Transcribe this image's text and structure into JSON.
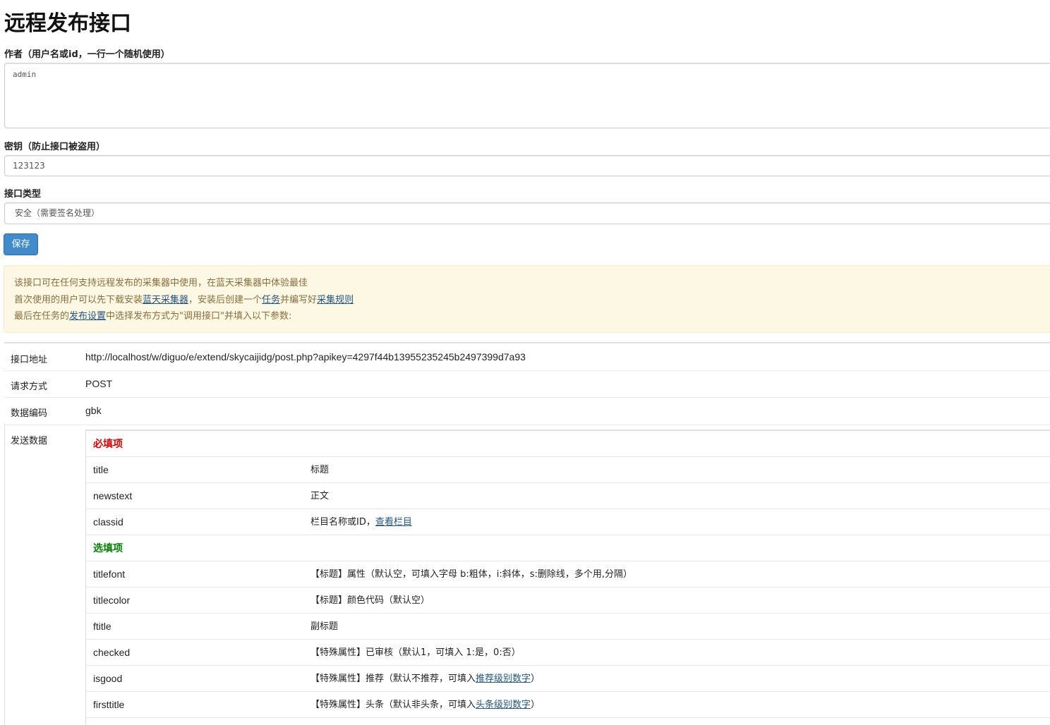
{
  "page": {
    "title": "远程发布接口"
  },
  "author": {
    "label": "作者（用户名或id，一行一个随机使用）",
    "value": "admin"
  },
  "key": {
    "label": "密钥（防止接口被盗用）",
    "value": "123123"
  },
  "api_type": {
    "label": "接口类型",
    "selected": "安全（需要签名处理）"
  },
  "save_button": "保存",
  "notice": {
    "line1": "该接口可在任何支持远程发布的采集器中使用，在蓝天采集器中体验最佳",
    "line2_a": "首次使用的用户可以先下载安装",
    "line2_link1": "蓝天采集器",
    "line2_b": "，安装后创建一个",
    "line2_link2": "任务",
    "line2_c": "并编写好",
    "line2_link3": "采集规则",
    "line3_a": "最后在任务的",
    "line3_link": "发布设置",
    "line3_b": "中选择发布方式为\"调用接口\"并填入以下参数:"
  },
  "info": {
    "url_label": "接口地址",
    "url_value": "http://localhost/w/diguo/e/extend/skycaijidg/post.php?apikey=4297f44b13955235245b2497399d7a93",
    "method_label": "请求方式",
    "method_value": "POST",
    "encoding_label": "数据编码",
    "encoding_value": "gbk",
    "data_label": "发送数据"
  },
  "params": {
    "required_title": "必填项",
    "required_color": "#dd0000",
    "optional_title": "选填项",
    "optional_color": "#008000",
    "required": [
      {
        "name": "title",
        "desc": "标题"
      },
      {
        "name": "newstext",
        "desc": "正文"
      },
      {
        "name": "classid",
        "desc": "栏目名称或ID，",
        "link": "查看栏目",
        "tail": ""
      }
    ],
    "optional": [
      {
        "name": "titlefont",
        "desc": "【标题】属性（默认空，可填入字母 b:粗体，i:斜体，s:删除线，多个用,分隔）"
      },
      {
        "name": "titlecolor",
        "desc": "【标题】颜色代码（默认空）"
      },
      {
        "name": "ftitle",
        "desc": "副标题"
      },
      {
        "name": "checked",
        "desc": "【特殊属性】已审核（默认1，可填入 1:是，0:否）"
      },
      {
        "name": "isgood",
        "desc": "【特殊属性】推荐（默认不推荐，可填入",
        "link": "推荐级别数字",
        "tail": "）"
      },
      {
        "name": "firsttitle",
        "desc": "【特殊属性】头条（默认非头条，可填入",
        "link": "头条级别数字",
        "tail": "）"
      }
    ]
  },
  "colors": {
    "primary_button": "#428bca",
    "notice_bg": "#fcf8e3",
    "notice_text": "#8a6d3b",
    "link": "#245580"
  }
}
